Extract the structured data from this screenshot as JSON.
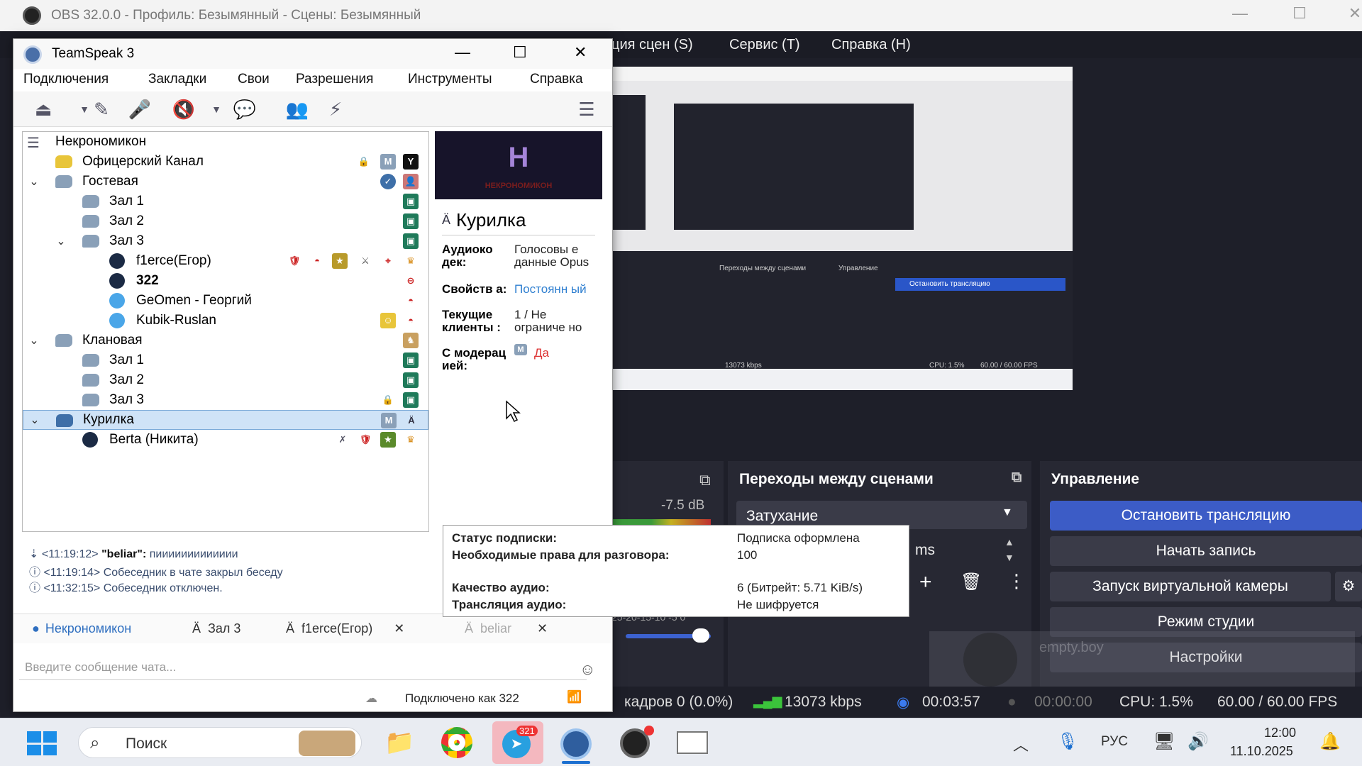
{
  "obs": {
    "title": "OBS 32.0.0 - Профиль: Безымянный - Сцены: Безымянный",
    "menu": [
      "ция сцен (S)",
      "Сервис (T)",
      "Справка (H)"
    ],
    "mixer_db": "-7.5 dB",
    "mixer_tail": "ms",
    "mixer_scale": "25-20-15-10 -5 0",
    "transitions_header": "Переходы между сценами",
    "transition_value": "Затухание",
    "controls_header": "Управление",
    "controls": [
      "Остановить трансляцию",
      "Начать запись",
      "Запуск виртуальной камеры",
      "Режим студии",
      "Настройки"
    ],
    "watermark_text": "empty.boy",
    "status": {
      "frames": "кадров 0 (0.0%)",
      "bitrate": "13073 kbps",
      "stream_time": "00:03:57",
      "rec_time": "00:00:00",
      "cpu": "CPU: 1.5%",
      "fps": "60.00 / 60.00 FPS"
    }
  },
  "teamspeak": {
    "title": "TeamSpeak 3",
    "menu": [
      "Подключения",
      "Закладки",
      "Свои",
      "Разрешения",
      "Инструменты",
      "Справка"
    ],
    "tree": {
      "server": "Некрономикон",
      "officer_channel": "Офицерский Канал",
      "guest": "Гостевая",
      "guest_zal1": "Зал 1",
      "guest_zal2": "Зал 2",
      "guest_zal3": "Зал 3",
      "client1": "f1erce(Егор)",
      "client2": "322",
      "client3": "GeOmen - Георгий",
      "client4": "Kubik-Ruslan",
      "clan": "Клановая",
      "clan_zal1": "Зал 1",
      "clan_zal2": "Зал 2",
      "clan_zal3": "Зал 3",
      "smoke": "Курилка",
      "client5": "Berta (Никита)"
    },
    "info": {
      "banner_letter": "H",
      "banner_text": "НЕКРОНОМИКОН",
      "channel_name": "Курилка",
      "codec_key": "Аудиоко дек:",
      "codec_val": "Голосовы е данные Opus",
      "props_key": "Свойств а:",
      "props_val": "Постоянн ый",
      "clients_key": "Текущие клиенты :",
      "clients_val": "1 / Не ограниче но",
      "moderated_key": "С модерац ией:",
      "moderated_val": "Да"
    },
    "chat": [
      {
        "time": "<11:19:12>",
        "name": "\"beliar\":",
        "text": "пиииииииииииии"
      },
      {
        "time": "<11:19:14>",
        "text": "Собеседник в чате закрыл беседу"
      },
      {
        "time": "<11:32:15>",
        "text": "Собеседник отключен."
      }
    ],
    "tabs": [
      "Некрономикон",
      "Зал 3",
      "f1erce(Егор)",
      "beliar"
    ],
    "chat_placeholder": "Введите сообщение чата...",
    "connected": "Подключено как 322"
  },
  "tooltip": {
    "sub_status_key": "Статус подписки:",
    "sub_status_val": "Подписка оформлена",
    "talk_power_key": "Необходимые права для разговора:",
    "talk_power_val": "100",
    "quality_key": "Качество аудио:",
    "quality_val": "6 (Битрейт: 5.71 KiB/s)",
    "encryption_key": "Трансляция аудио:",
    "encryption_val": "Не шифруется"
  },
  "taskbar": {
    "search": "Поиск",
    "telegram_badge": "321",
    "lang": "РУС",
    "time": "12:00",
    "date": "11.10.2025"
  }
}
